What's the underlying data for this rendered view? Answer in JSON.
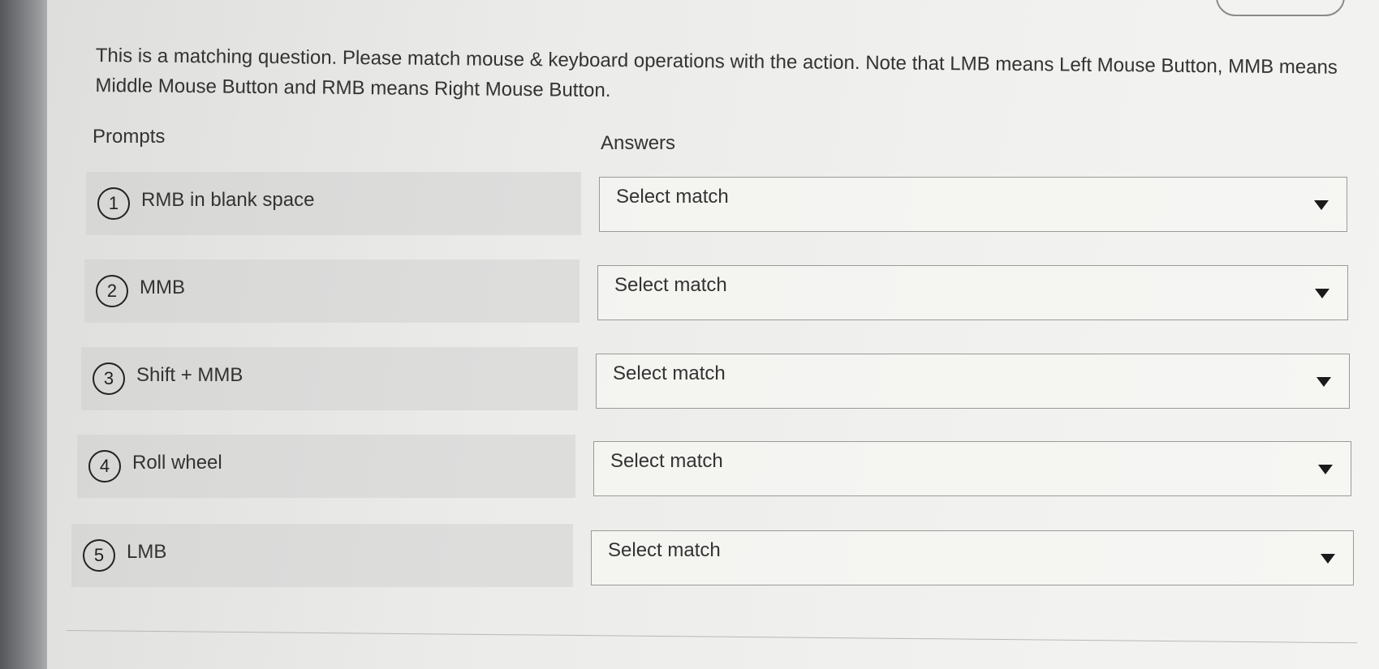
{
  "question": {
    "text": "This is a matching question. Please match mouse & keyboard operations with the action. Note that LMB means Left Mouse Button, MMB means Middle Mouse Button and RMB means Right Mouse Button."
  },
  "columns": {
    "prompts_label": "Prompts",
    "answers_label": "Answers"
  },
  "prompts": [
    {
      "number": "1",
      "label": "RMB in blank space",
      "selected": "Select match"
    },
    {
      "number": "2",
      "label": "MMB",
      "selected": "Select match"
    },
    {
      "number": "3",
      "label": "Shift + MMB",
      "selected": "Select match"
    },
    {
      "number": "4",
      "label": "Roll wheel",
      "selected": "Select match"
    },
    {
      "number": "5",
      "label": "LMB",
      "selected": "Select match"
    }
  ],
  "icons": {
    "dropdown": "chevron-down-icon"
  }
}
